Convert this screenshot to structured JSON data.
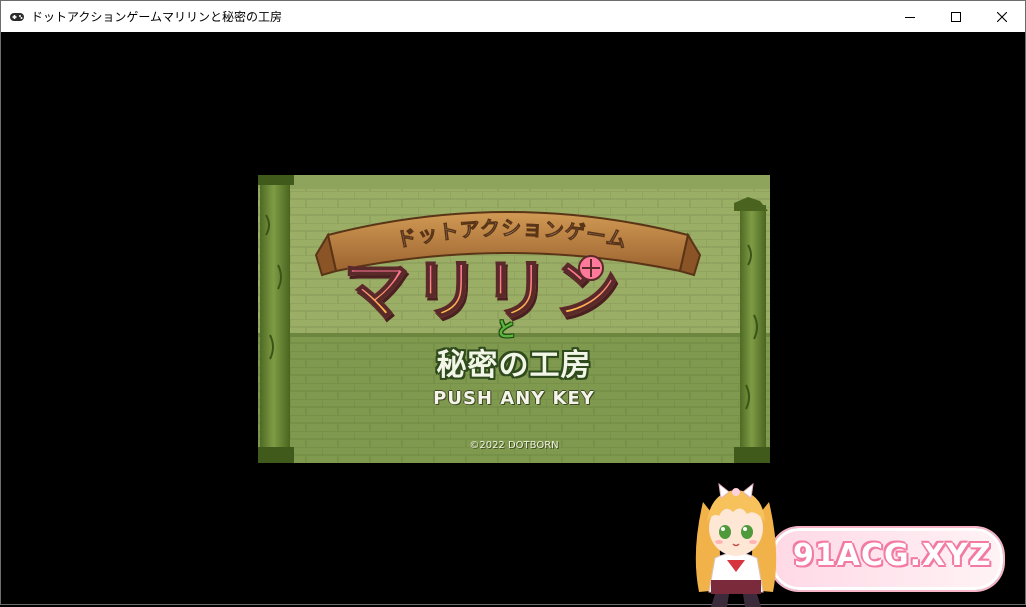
{
  "window": {
    "title": "ドットアクションゲームマリリンと秘密の工房",
    "icon": "gamepad-icon",
    "controls": {
      "minimize_icon": "minimize-icon",
      "maximize_icon": "maximize-icon",
      "close_icon": "close-icon"
    }
  },
  "title_screen": {
    "ribbon_text": "ドットアクションゲーム",
    "main_title": "マリリン",
    "connector": "と",
    "subtitle": "秘密の工房",
    "prompt": "PUSH ANY KEY",
    "copyright": "©2022 DOTBORN"
  },
  "watermark": {
    "text": "91ACG.XYZ"
  },
  "colors": {
    "wall": "#7f9a4f",
    "wall_upper": "#9aae66",
    "pillar": "#5d7a2c",
    "ribbon": "#b37a3a",
    "title_pink": "#ff5fae",
    "title_yellow": "#ffe33c",
    "subtitle_outline": "#2f4a1c",
    "watermark_pink": "#f27aa3"
  }
}
